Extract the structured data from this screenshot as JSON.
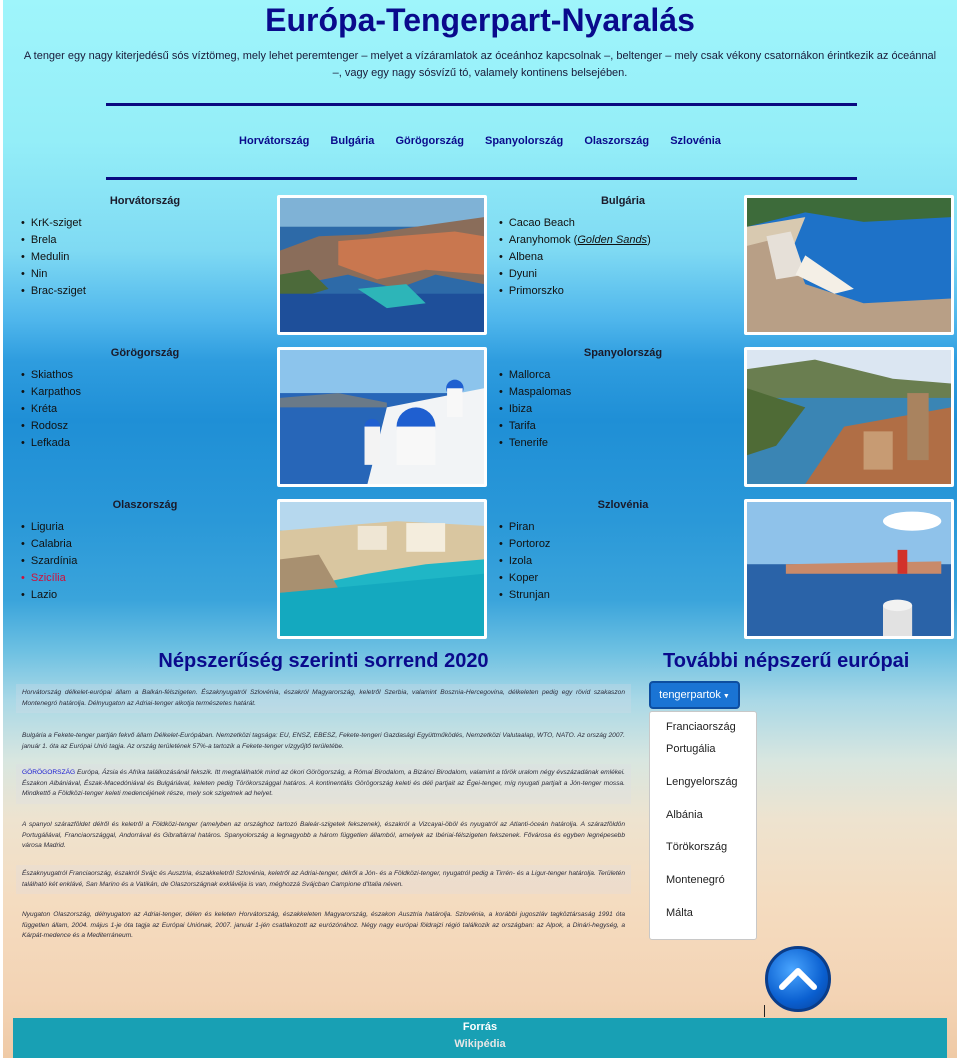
{
  "header": {
    "title": "Európa-Tengerpart-Nyaralás",
    "intro": "A tenger egy nagy kiterjedésű sós víztömeg, mely lehet peremtenger – melyet a vízáramlatok az óceánhoz kapcsolnak –, beltenger – mely csak vékony csatornákon érintkezik az óceánnal –, vagy egy nagy sósvízű tó, valamely kontinens belsejében."
  },
  "nav": [
    "Horvátország",
    "Bulgária",
    "Görögország",
    "Spanyolország",
    "Olaszország",
    "Szlovénia"
  ],
  "countries": [
    {
      "name": "Horvátország",
      "items": [
        "KrK-sziget",
        "Brela",
        "Medulin",
        "Nin",
        "Brac-sziget"
      ]
    },
    {
      "name": "Bulgária",
      "items": [
        "Cacao Beach",
        "Aranyhomok (",
        "Golden Sands",
        ")",
        "Albena",
        "Dyuni",
        "Primorszko"
      ]
    },
    {
      "name": "Görögország",
      "items": [
        "Skiathos",
        "Karpathos",
        "Kréta",
        "Rodosz",
        "Lefkada"
      ]
    },
    {
      "name": "Spanyolország",
      "items": [
        "Mallorca",
        "Maspalomas",
        "Ibiza",
        "Tarifa",
        "Tenerife"
      ]
    },
    {
      "name": "Olaszország",
      "items": [
        "Liguria",
        "Calabria",
        "Szardínia",
        "Szicília",
        "Lazio"
      ]
    },
    {
      "name": "Szlovénia",
      "items": [
        "Piran",
        "Portoroz",
        "Izola",
        "Koper",
        "Strunjan"
      ]
    }
  ],
  "popularity": {
    "title": "Népszerűség szerinti sorrend 2020",
    "paragraphs": [
      "Horvátország délkelet-európai állam a Balkán-félszigeten. Északnyugatról Szlovénia, északról Magyarország, keletről Szerbia, valamint Bosznia-Hercegovina, délkeleten pedig egy rövid szakaszon Montenegró határolja. Délnyugaton az Adriai-tenger alkotja természetes határát.",
      "Bulgária a Fekete-tenger partján fekvő állam Délkelet-Európában. Nemzetközi tagsága: EU, ENSZ, EBESZ, Fekete-tengeri Gazdasági Együttműködés, Nemzetközi Valutaalap, WTO, NATO. Az ország 2007. január 1. óta az Európai Unió tagja. Az ország területének 57%-a tartozik a Fekete-tenger vízgyűjtő területébe.",
      "GÖRÖGORSZÁG",
      " Európa, Ázsia és Afrika találkozásánál fekszik. Itt megtalálhatók mind az ókori Görögország, a Római Birodalom, a Bizánci Birodalom, valamint a török uralom négy évszázadának emlékei. Északon Albániával, Észak-Macedóniával és Bulgáriával, keleten pedig Törökországgal határos. A kontinentális Görögország keleti és déli partjait az Égei-tenger, míg nyugati partjait a Jón-tenger mossa. Mindkettő a Földközi-tenger keleti medencéjének része, mely sok szigetnek ad helyet.",
      "A spanyol szárazföldet délről és keletről a Földközi-tenger (amelyben az országhoz tartozó Baleár-szigetek fekszenek), északról a Vizcayai-öböl és nyugatról az Atlanti-óceán határolja. A szárazföldön Portugáliával, Franciaországgal, Andorrával és Gibraltárral határos. Spanyolország a legnagyobb a három független államból, amelyek az Ibériai-félszigeten fekszenek. Fővárosa és egyben legnépesebb városa Madrid.",
      "Északnyugatról Franciaország, északról Svájc és Ausztria, északkeletről Szlovénia, keletről az Adriai-tenger, délről a Jón- és a Földközi-tenger, nyugatról pedig a Tirrén- és a Ligur-tenger határolja. Területén található két enklávé, San Marino és a Vatikán, de Olaszországnak exklávéja is van, méghozzá Svájcban Campione d'Italia néven.",
      "Nyugaton Olaszország, délnyugaton az Adriai-tenger, délen és keleten Horvátország, északkeleten Magyarország, északon Ausztria határolja. Szlovénia, a korábbi jugoszláv tagköztársaság 1991 óta független állam, 2004. május 1-je óta tagja az Európai Uniónak, 2007. január 1-jén csatlakozott az eurózónához. Négy nagy európai földrajzi régió találkozik az országban: az Alpok, a Dinári-hegység, a Kárpát-medence és a Mediterráneum."
    ]
  },
  "more": {
    "title": "További népszerű európai",
    "dropdown_label": "tengerpartok",
    "options": [
      "Franciaország",
      "Portugália",
      "Lengyelország",
      "Albánia",
      "Törökország",
      "Montenegró",
      "Málta"
    ]
  },
  "footer": {
    "line1": "Forrás",
    "line2": "Wikipédia"
  },
  "colors": {
    "title": "#0a0a8c",
    "footer": "#18a0b4",
    "button": "#1a74d4",
    "highlight": "#d0103a"
  }
}
